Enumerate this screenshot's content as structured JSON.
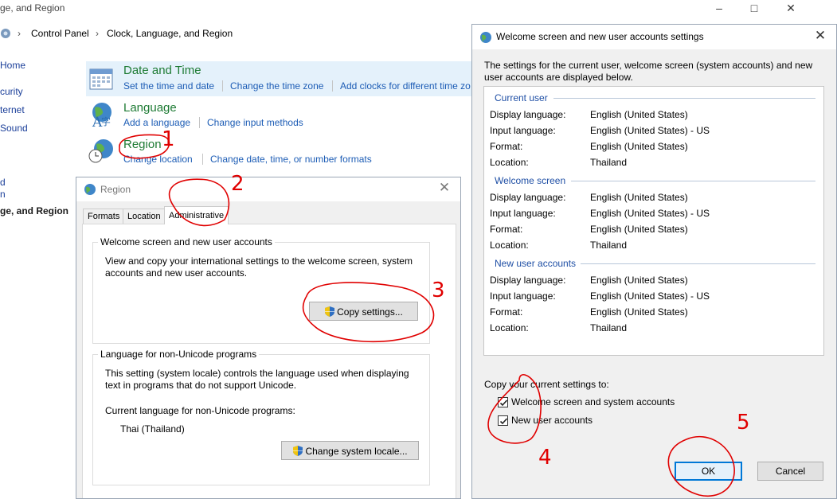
{
  "control_panel": {
    "title": "ge, and Region",
    "breadcrumb": [
      "Control Panel",
      "Clock, Language, and Region"
    ],
    "sidebar": [
      "Home",
      "curity",
      "ternet",
      "Sound",
      "d",
      "n",
      "ge, and Region"
    ],
    "categories": [
      {
        "title": "Date and Time",
        "links": [
          "Set the time and date",
          "Change the time zone",
          "Add clocks for different time zo"
        ]
      },
      {
        "title": "Language",
        "links": [
          "Add a language",
          "Change input methods"
        ]
      },
      {
        "title": "Region",
        "links": [
          "Change location",
          "Change date, time, or number formats"
        ]
      }
    ]
  },
  "region_dialog": {
    "title": "Region",
    "tabs": [
      "Formats",
      "Location",
      "Administrative"
    ],
    "active_tab": "Administrative",
    "welcome_group": {
      "title": "Welcome screen and new user accounts",
      "description": "View and copy your international settings to the welcome screen, system accounts and new user accounts.",
      "button": "Copy settings..."
    },
    "unicode_group": {
      "title": "Language for non-Unicode programs",
      "description": "This setting (system locale) controls the language used when displaying text in programs that do not support Unicode.",
      "current_label": "Current language for non-Unicode programs:",
      "current_value": "Thai (Thailand)",
      "button": "Change system locale..."
    }
  },
  "welcome_dialog": {
    "title": "Welcome screen and new user accounts settings",
    "intro": "The settings for the current user, welcome screen (system accounts) and new user accounts are displayed below.",
    "sections": [
      {
        "heading": "Current user",
        "rows": [
          {
            "label": "Display language:",
            "value": "English (United States)"
          },
          {
            "label": "Input language:",
            "value": "English (United States) - US"
          },
          {
            "label": "Format:",
            "value": "English (United States)"
          },
          {
            "label": "Location:",
            "value": "Thailand"
          }
        ]
      },
      {
        "heading": "Welcome screen",
        "rows": [
          {
            "label": "Display language:",
            "value": "English (United States)"
          },
          {
            "label": "Input language:",
            "value": "English (United States) - US"
          },
          {
            "label": "Format:",
            "value": "English (United States)"
          },
          {
            "label": "Location:",
            "value": "Thailand"
          }
        ]
      },
      {
        "heading": "New user accounts",
        "rows": [
          {
            "label": "Display language:",
            "value": "English (United States)"
          },
          {
            "label": "Input language:",
            "value": "English (United States) - US"
          },
          {
            "label": "Format:",
            "value": "English (United States)"
          },
          {
            "label": "Location:",
            "value": "Thailand"
          }
        ]
      }
    ],
    "copy_label": "Copy your current settings to:",
    "checkboxes": [
      {
        "label": "Welcome screen and system accounts",
        "checked": true
      },
      {
        "label": "New user accounts",
        "checked": true
      }
    ],
    "ok": "OK",
    "cancel": "Cancel"
  },
  "annotations": {
    "numbers": [
      "1",
      "2",
      "3",
      "4",
      "5"
    ],
    "color": "#e00000"
  },
  "colors": {
    "link": "#1c5cb5",
    "category_title": "#1e7b34",
    "section_heading": "#1f4fa5",
    "focus_border": "#0078d7"
  }
}
